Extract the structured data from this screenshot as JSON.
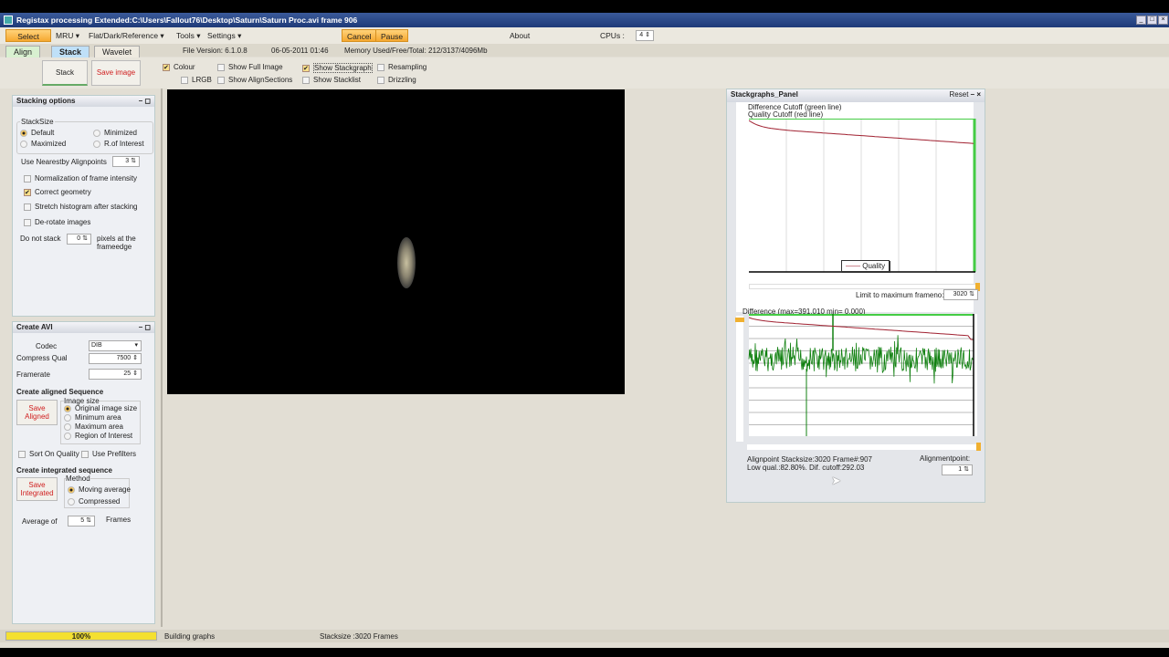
{
  "title": "Registax processing Extended:C:\\Users\\Fallout76\\Desktop\\Saturn\\Saturn Proc.avi frame 906",
  "menu": {
    "select": "Select",
    "mru": "MRU",
    "flat": "Flat/Dark/Reference",
    "tools": "Tools",
    "settings": "Settings",
    "cancel": "Cancel",
    "pause": "Pause",
    "about": "About",
    "cpus_label": "CPUs :",
    "cpus": "4"
  },
  "tabs": [
    "Align",
    "Stack",
    "Wavelet"
  ],
  "info": {
    "version": "File Version: 6.1.0.8",
    "date": "06-05-2011 01:46",
    "memory": "Memory Used/Free/Total: 212/3137/4096Mb"
  },
  "toolbar": {
    "stack": "Stack",
    "save_image": "Save image",
    "options": [
      {
        "label": "Colour",
        "checked": true
      },
      {
        "label": "LRGB",
        "checked": false
      },
      {
        "label": "Show Full Image",
        "checked": false
      },
      {
        "label": "Show AlignSections",
        "checked": false
      },
      {
        "label": "Show Stackgraph",
        "checked": true
      },
      {
        "label": "Show Stacklist",
        "checked": false
      },
      {
        "label": "Resampling",
        "checked": false
      },
      {
        "label": "Drizzling",
        "checked": false
      }
    ]
  },
  "stacking": {
    "title": "Stacking options",
    "stacksize": "StackSize",
    "default": "Default",
    "minimized": "Minimized",
    "maximized": "Maximized",
    "roi": "R.of Interest",
    "nearest_label": "Use Nearestby Alignpoints",
    "nearest": "3",
    "normalize": "Normalization of frame intensity",
    "correct": "Correct geometry",
    "stretch": "Stretch histogram after stacking",
    "derotate": "De-rotate images",
    "donot": "Do not stack",
    "donot_val": "0",
    "pixels": "pixels at the frameedge"
  },
  "avi": {
    "title": "Create AVI",
    "codec_label": "Codec",
    "codec": "DIB",
    "qual_label": "Compress Qual",
    "qual": "7500",
    "rate_label": "Framerate",
    "rate": "25",
    "aligned_title": "Create aligned Sequence",
    "save_aligned": "Save Aligned",
    "image_size": "Image size",
    "sizes": [
      "Original image size",
      "Minimum area",
      "Maximum area",
      "Region of Interest"
    ],
    "sort": "Sort On Quality",
    "prefilters": "Use Prefilters",
    "integrated_title": "Create integrated sequence",
    "save_integrated": "Save Integrated",
    "method": "Method",
    "moving": "Moving average",
    "compressed": "Compressed",
    "avg_label": "Average of",
    "avg": "5",
    "frames": "Frames"
  },
  "graphs": {
    "title": "Stackgraphs_Panel",
    "reset": "Reset",
    "legend1": "Difference Cutoff (green line)",
    "legend2": "Quality Cutoff (red line)",
    "quality": "Quality",
    "limit_label": "Limit to maximum frameno:",
    "limit": "3020",
    "difference": "Difference (max=391.010 min= 0.000)",
    "info1": "Alignpoint Stacksize:3020 Frame#:907",
    "info2": "Low qual.:82.80%. Dif. cutoff:292.03",
    "ap_label": "Alignmentpoint:",
    "ap": "1"
  },
  "status": {
    "progress_text": "100%",
    "progress": 1.0,
    "task": "Building graphs",
    "stacksize": "Stacksize :3020 Frames"
  }
}
